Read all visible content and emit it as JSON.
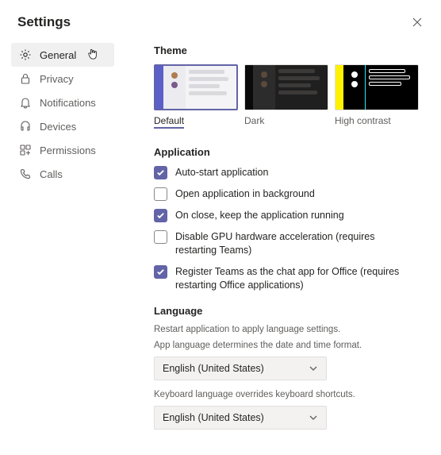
{
  "header": {
    "title": "Settings"
  },
  "sidebar": {
    "items": [
      {
        "label": "General"
      },
      {
        "label": "Privacy"
      },
      {
        "label": "Notifications"
      },
      {
        "label": "Devices"
      },
      {
        "label": "Permissions"
      },
      {
        "label": "Calls"
      }
    ]
  },
  "theme": {
    "title": "Theme",
    "options": [
      {
        "label": "Default"
      },
      {
        "label": "Dark"
      },
      {
        "label": "High contrast"
      }
    ]
  },
  "application": {
    "title": "Application",
    "items": [
      {
        "label": "Auto-start application",
        "checked": true
      },
      {
        "label": "Open application in background",
        "checked": false
      },
      {
        "label": "On close, keep the application running",
        "checked": true
      },
      {
        "label": "Disable GPU hardware acceleration (requires restarting Teams)",
        "checked": false
      },
      {
        "label": "Register Teams as the chat app for Office (requires restarting Office applications)",
        "checked": true
      }
    ]
  },
  "language": {
    "title": "Language",
    "hint1": "Restart application to apply language settings.",
    "hint2": "App language determines the date and time format.",
    "select1": "English (United States)",
    "hint3": "Keyboard language overrides keyboard shortcuts.",
    "select2": "English (United States)"
  }
}
